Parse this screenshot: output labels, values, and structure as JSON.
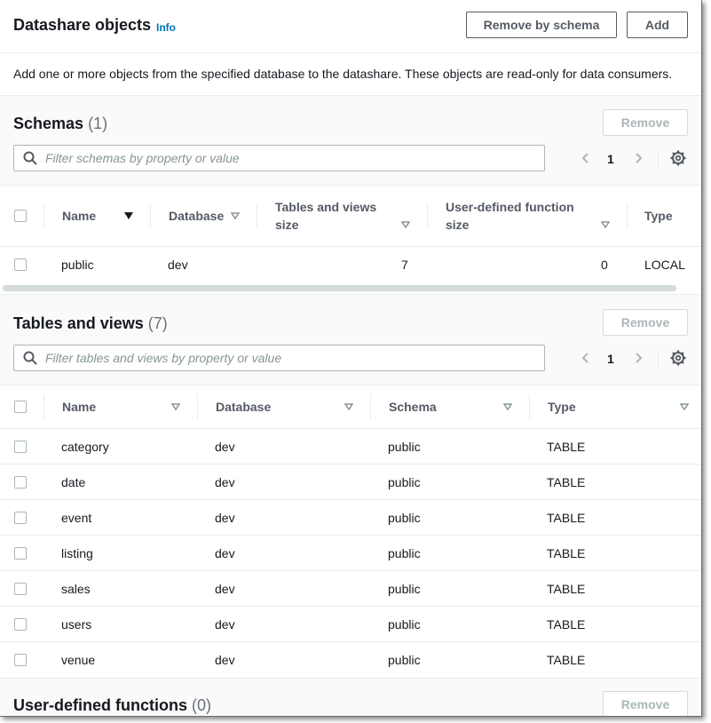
{
  "header": {
    "title": "Datashare objects",
    "info": "Info",
    "remove_by_schema": "Remove by schema",
    "add": "Add",
    "description": "Add one or more objects from the specified database to the datashare. These objects are read-only for data consumers."
  },
  "schemas": {
    "title": "Schemas",
    "count": "(1)",
    "remove": "Remove",
    "search_placeholder": "Filter schemas by property or value",
    "page": "1",
    "columns": {
      "name": "Name",
      "database": "Database",
      "tv_line1": "Tables and views",
      "tv_line2": "size",
      "udf_line1": "User-defined function",
      "udf_line2": "size",
      "type": "Type"
    },
    "rows": [
      {
        "name": "public",
        "database": "dev",
        "tables_views": "7",
        "udf": "0",
        "type": "LOCAL"
      }
    ]
  },
  "tables": {
    "title": "Tables and views",
    "count": "(7)",
    "remove": "Remove",
    "search_placeholder": "Filter tables and views by property or value",
    "page": "1",
    "columns": {
      "name": "Name",
      "database": "Database",
      "schema": "Schema",
      "type": "Type"
    },
    "rows": [
      {
        "name": "category",
        "database": "dev",
        "schema": "public",
        "type": "TABLE"
      },
      {
        "name": "date",
        "database": "dev",
        "schema": "public",
        "type": "TABLE"
      },
      {
        "name": "event",
        "database": "dev",
        "schema": "public",
        "type": "TABLE"
      },
      {
        "name": "listing",
        "database": "dev",
        "schema": "public",
        "type": "TABLE"
      },
      {
        "name": "sales",
        "database": "dev",
        "schema": "public",
        "type": "TABLE"
      },
      {
        "name": "users",
        "database": "dev",
        "schema": "public",
        "type": "TABLE"
      },
      {
        "name": "venue",
        "database": "dev",
        "schema": "public",
        "type": "TABLE"
      }
    ]
  },
  "udfs": {
    "title": "User-defined functions",
    "count": "(0)",
    "remove": "Remove"
  },
  "icons": {
    "search": "search-icon",
    "gear": "gear-icon",
    "chevron_left": "chevron-left-icon",
    "chevron_right": "chevron-right-icon",
    "sort_desc": "sort-descending-icon",
    "sort_neutral": "sort-neutral-icon"
  },
  "colors": {
    "info_link": "#0073bb",
    "text": "#16191f",
    "secondary_text": "#545b64",
    "disabled": "#aab7b8"
  }
}
